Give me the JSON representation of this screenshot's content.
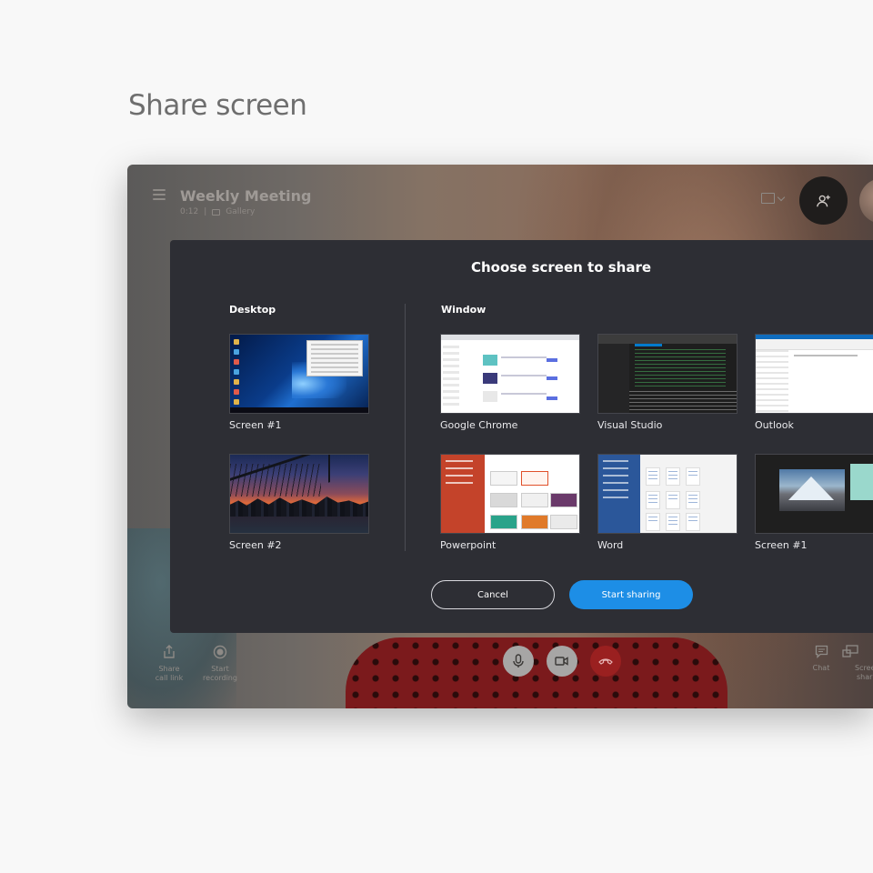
{
  "page": {
    "heading": "Share screen"
  },
  "meeting": {
    "title": "Weekly Meeting",
    "elapsed": "0:12",
    "separator": "|",
    "view_mode": "Gallery"
  },
  "modal": {
    "title": "Choose screen to share",
    "desktop_label": "Desktop",
    "window_label": "Window",
    "desktop_items": [
      {
        "label": "Screen #1"
      },
      {
        "label": "Screen #2"
      }
    ],
    "window_items": [
      {
        "label": "Google Chrome"
      },
      {
        "label": "Visual Studio"
      },
      {
        "label": "Outlook"
      },
      {
        "label": "Powerpoint"
      },
      {
        "label": "Word"
      },
      {
        "label": "Screen #1"
      }
    ],
    "cancel_label": "Cancel",
    "share_label": "Start sharing"
  },
  "bottom_bar": {
    "share_link_line1": "Share",
    "share_link_line2": "call link",
    "record_line1": "Start",
    "record_line2": "recording",
    "chat_label": "Chat",
    "screen_share_line1": "Scree",
    "screen_share_line2": "shar"
  },
  "colors": {
    "accent": "#1d8ee6",
    "modal_bg": "#2d2e34",
    "hangup": "#9a2020"
  }
}
